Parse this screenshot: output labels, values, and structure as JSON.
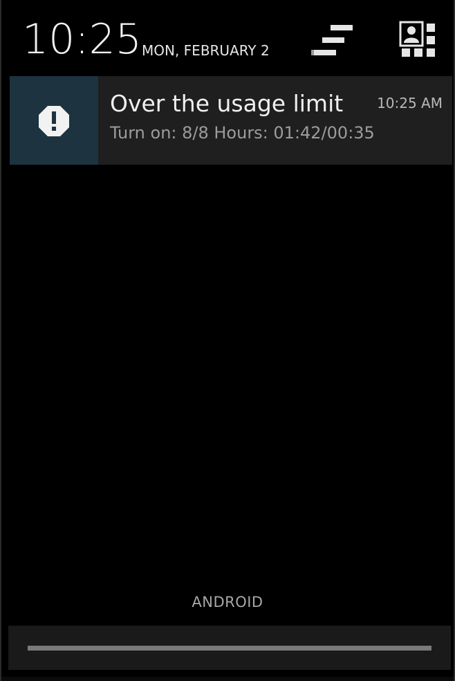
{
  "header": {
    "time": "10:25",
    "date": "MON, FEBRUARY 2",
    "clear_icon": "clear-all-icon",
    "settings_icon": "quick-settings-icon"
  },
  "notification": {
    "icon": "warning-icon",
    "title": "Over the usage limit",
    "time": "10:25 AM",
    "text": "Turn on: 8/8 Hours: 01:42/00:35",
    "colors": {
      "icon_background": "#1d3340",
      "card_background": "#1f1f1f"
    }
  },
  "carrier": "ANDROID",
  "drag_handle": {
    "icon": "drag-handle-icon"
  }
}
